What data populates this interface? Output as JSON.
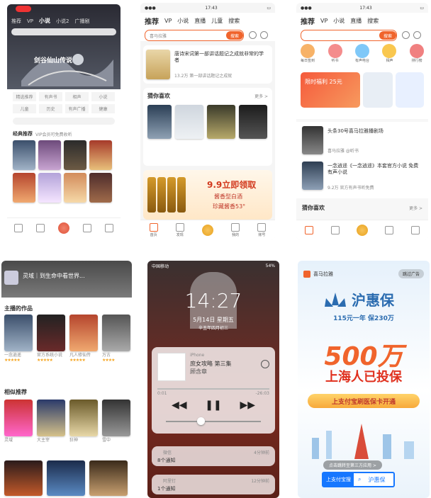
{
  "panel1": {
    "tabs": [
      "推荐",
      "VP",
      "小说",
      "小说2",
      "广播剧",
      "相声"
    ],
    "banner_title": "剑谷仙山传说",
    "chips": [
      "精选推荐",
      "有声书",
      "相声",
      "小说",
      "儿童",
      "历史",
      "有声广播",
      "健康"
    ],
    "section_title": "经典推荐",
    "section_sub": "VIP会员可免费收听"
  },
  "panel2": {
    "status_time": "17:43",
    "tabs": [
      "推荐",
      "VP",
      "小说",
      "直播",
      "儿童",
      "搜索"
    ],
    "search_placeholder": "喜马拉雅",
    "search_btn": "搜索",
    "list_title": "唐诗宋词第一部讲话题记之成就非常的学者",
    "list_meta": "13.2万  第一部讲话题记之成就",
    "guess_title": "猜你喜欢",
    "guess_more": "更多 >",
    "promo_title": "9.9立即领取",
    "promo_line2": "酱香型白酒",
    "promo_line3": "珍藏酱香53°",
    "tab_labels": [
      "首页",
      "发现",
      "",
      "我的",
      "账号"
    ]
  },
  "panel3": {
    "status_time": "17:43",
    "tabs": [
      "推荐",
      "VP",
      "小说",
      "直播",
      "搜索"
    ],
    "search_btn": "搜索",
    "icons": [
      "每日签到",
      "听书",
      "有声电台",
      "相声",
      "排行榜"
    ],
    "banner_text": "限时福利 25元",
    "item1_title": "头条30号喜马拉雅播剧场",
    "item1_meta": "喜马拉雅 @听书",
    "item2_title": "一念逍遥《一念逍遥》本套官方小说 免费有声小说",
    "item2_meta": "9.2万  官方有声书听免费",
    "guess_title": "猜你喜欢",
    "guess_more": "更多 >"
  },
  "panel4": {
    "header_text": "灵域｜到生命中看世界...",
    "section1": "主播的作品",
    "books1": [
      "一念逍遥",
      "官方系统小说",
      "凡人修仙传",
      "万古"
    ],
    "section2": "相似推荐",
    "books2": [
      "灵域",
      "大主宰",
      "狂神",
      "雪中"
    ]
  },
  "panel5": {
    "carrier": "中国移动",
    "battery": "54%",
    "time": "14:27",
    "date": "5月14日 星期五",
    "lunar": "辛丑年四月初三",
    "source": "iPhone",
    "track_title": "庶女攻略 第三集",
    "track_sub": "顾含章",
    "elapsed": "0:01",
    "remaining": "-26:03",
    "n1_app": "微信",
    "n1_time": "4分钟前",
    "n1_text": "8个通知",
    "n2_app": "阿里钉",
    "n2_time": "12分钟前",
    "n2_text": "1个通知"
  },
  "panel6": {
    "brand": "喜马拉雅",
    "skip": "跳过广告",
    "product": "沪惠保",
    "tagline": "115元一年  保230万",
    "big_number": "500万",
    "big_line": "上海人已投保",
    "cta": "上支付宝刷医保卡开通",
    "cta_hint": "点击跳转至第三方应用 >",
    "search_label": "上支付宝搜",
    "search_value": "沪惠保"
  }
}
